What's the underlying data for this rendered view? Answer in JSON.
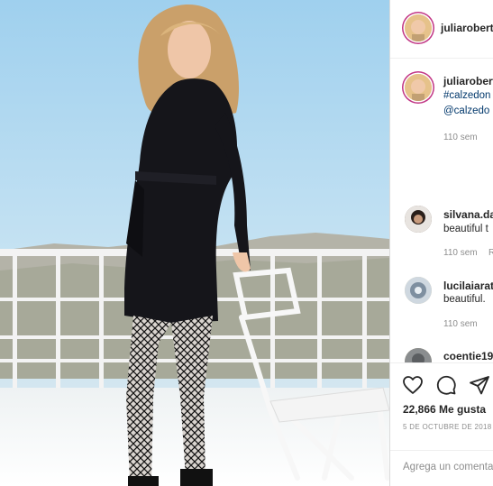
{
  "post": {
    "username": "juliaroberts",
    "caption_user": "juliaroberts",
    "caption_hashtag": "#calzedon",
    "caption_mention": "@calzedo",
    "caption_time": "110 sem"
  },
  "comments": [
    {
      "user": "silvana.da",
      "text": "beautiful t",
      "time": "110 sem",
      "reply": "R"
    },
    {
      "user": "lucilaiarat",
      "text": "beautiful.",
      "time": "110 sem"
    },
    {
      "user": "coentie19"
    }
  ],
  "actions": {
    "likes": "22,866 Me gusta",
    "date": "5 DE OCTUBRE DE 2018",
    "add_comment_placeholder": "Agrega un comentario..."
  },
  "icons": [
    "heart-icon",
    "comment-icon",
    "share-icon"
  ]
}
